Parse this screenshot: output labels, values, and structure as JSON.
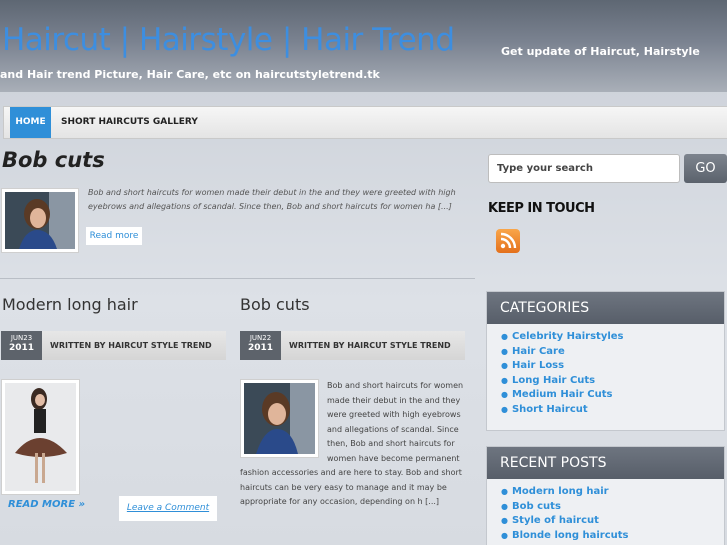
{
  "header": {
    "site_title": "Haircut | Hairstyle | Hair Trend",
    "tagline": "Get update of Haircut, Hairstyle and Hair trend Picture, Hair Care, etc on haircutstyletrend.tk"
  },
  "nav": {
    "home": "HOME",
    "short_haircuts": "SHORT HAIRCUTS GALLERY"
  },
  "featured": {
    "title": "Bob cuts",
    "excerpt": "Bob and short haircuts for women made their debut in the and they were greeted with high eyebrows and allegations of scandal. Since then, Bob and short haircuts for women ha [...]",
    "read_more": "Read more"
  },
  "search": {
    "placeholder": "Type your search",
    "button": "GO"
  },
  "keep_in_touch": "KEEP IN TOUCH",
  "posts": [
    {
      "title": "Modern long hair",
      "month_day": "JUN23",
      "year": "2011",
      "author": "WRITTEN BY HAIRCUT STYLE TREND",
      "read_more": "READ MORE »",
      "leave_comment": "Leave a Comment"
    },
    {
      "title": "Bob cuts",
      "month_day": "JUN22",
      "year": "2011",
      "author": "WRITTEN BY HAIRCUT STYLE TREND",
      "excerpt": "Bob and short haircuts for women made their debut in the and they were greeted with high eyebrows and allegations of scandal. Since then, Bob and short haircuts for women have become permanent fashion accessories and are here to stay. Bob and short haircuts can be very easy to manage and it may be appropriate for any occasion, depending on h [...]"
    }
  ],
  "categories": {
    "title": "CATEGORIES",
    "items": [
      "Celebrity Hairstyles",
      "Hair Care",
      "Hair Loss",
      "Long Hair Cuts",
      "Medium Hair Cuts",
      "Short Haircut"
    ]
  },
  "recent_posts": {
    "title": "RECENT POSTS",
    "items": [
      "Modern long hair",
      "Bob cuts",
      "Style of haircut",
      "Blonde long haircuts"
    ]
  },
  "colors": {
    "accent": "#2f8fd8",
    "title_blue": "#3d8ee0",
    "rss": "#f08a2c"
  }
}
